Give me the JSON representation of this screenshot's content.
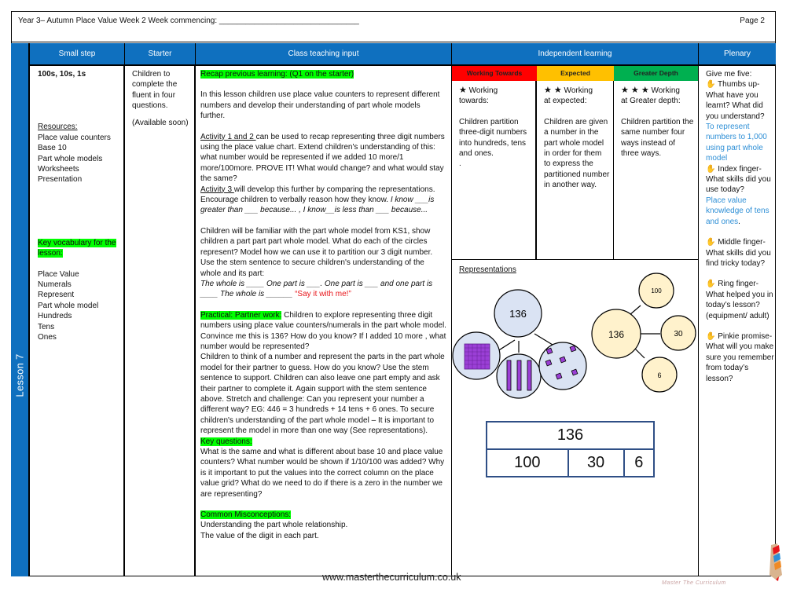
{
  "header": {
    "title": "Year 3– Autumn Place Value Week 2 Week commencing: ________________________________",
    "page": "Page 2"
  },
  "lesson_label": "Lesson 7",
  "columns": {
    "small_step": "Small step",
    "starter": "Starter",
    "class_teaching": "Class teaching input",
    "independent": "Independent learning",
    "plenary": "Plenary"
  },
  "small_step": {
    "title": "100s, 10s, 1s",
    "resources_heading": "Resources:",
    "resources": [
      "Place value counters",
      "Base 10",
      "Part whole models",
      "Worksheets",
      "Presentation"
    ],
    "vocab_heading": "Key vocabulary for the lesson:",
    "vocab": [
      "Place Value",
      "Numerals",
      "Represent",
      "Part whole model",
      "Hundreds",
      "Tens",
      "Ones"
    ]
  },
  "starter": {
    "text": "Children to complete the fluent in four questions.",
    "note": "(Available soon)"
  },
  "teaching": {
    "recap": "Recap previous learning: (Q1 on the starter)",
    "intro": "In this lesson children use place value counters to represent different numbers and develop their understanding of part whole models further.",
    "act12_label": "Activity 1 and 2 ",
    "act12_text": "can be used to recap representing three digit numbers using the place value chart.  Extend children's understanding of this:  what number would be represented if we added 10 more/1 more/100more.  PROVE IT!  What would change? and what would stay the same?",
    "act3_label": "Activity 3 ",
    "act3_text": "will develop this further by comparing the representations.  Encourage children to verbally reason how they know. ",
    "act3_italic": "I know ___is greater than ___ because... , I know__is less than ___ because...",
    "pw_intro": "Children will be familiar with the  part whole model from KS1, show children a part part part whole model. What do each of the circles represent?  Model how we can use it to partition our 3 digit number. Use the stem sentence to secure children's understanding of the whole and its part:",
    "stem_sentence": "The whole is ____ One part is ___. One part is ___ and one part is ____ The whole is ______ ",
    "say_it": "“Say it with me!”",
    "practical_label": "Practical:   Partner work:",
    "practical_text": " Children to explore representing three digit numbers using place value counters/numerals  in the part whole model.  Convince me this is 136? How do you know?  If I added 10 more , what number would be represented?",
    "partner_text": "Children to  think of a number and  represent the parts in the part whole model for their partner to guess.  How do you know? Use the stem sentence to support.  Children can also leave one part empty and ask their partner to complete it.  Again support with the stem sentence above.   Stretch and challenge:  Can you represent your number a different way?  EG: 446 = 3 hundreds + 14 tens + 6 ones. To secure children's understanding of the part whole model – It is important to represent the model  in more than one way (See representations).",
    "key_q_label": "Key questions:",
    "key_q_text": "What is the same and what is different about base 10 and place value counters?  What number would be shown if 1/10/100 was added? Why is it important to put the values into the correct column on the place value grid? What do we need to do if there is a zero in the number we are representing?",
    "misconceptions_label": " Common Misconceptions:",
    "misconceptions": [
      "Understanding the part whole relationship.",
      " The value of the digit in each part."
    ]
  },
  "independent": {
    "bands": [
      {
        "label": "Working Towards",
        "color": "#ff0000"
      },
      {
        "label": "Expected",
        "color": "#ffc000"
      },
      {
        "label": "Greater Depth",
        "color": "#00b050"
      }
    ],
    "working_towards": {
      "stars": "★",
      "heading_a": " Working",
      "heading_b": "towards:",
      "text": "Children partition three-digit numbers into hundreds, tens and ones.",
      "trail": "."
    },
    "expected": {
      "stars": "★ ★",
      "heading_a": " Working",
      "heading_b": "at expected:",
      "text": "Children are given a number in the part whole model in order for them to express the partitioned number in another way."
    },
    "greater_depth": {
      "stars": "★ ★ ★",
      "heading_a": " Working",
      "heading_b": "at Greater depth:",
      "text": "Children partition the same number four ways instead of three ways."
    },
    "representations_heading": "Representations",
    "model_a": {
      "whole": "136"
    },
    "model_b": {
      "whole": "136",
      "parts": [
        "100",
        "30",
        "6"
      ]
    },
    "bar_model": {
      "whole": "136",
      "parts": [
        "100",
        "30",
        "6"
      ]
    }
  },
  "plenary": {
    "intro": "Give me five:",
    "hand_icon": "✋",
    "items": [
      {
        "label": " Thumbs up- What have you learnt? What did you understand?",
        "answer": "To represent numbers to 1,000 using part whole model"
      },
      {
        "label": " Index finger- What skills did you use today?",
        "answer": "Place value knowledge of tens and ones"
      },
      {
        "label": " Middle finger- What skills did you find tricky today?"
      },
      {
        "label": " Ring finger- What helped you in today’s lesson? (equipment/ adult)"
      },
      {
        "label": " Pinkie promise- What will you make sure you remember from today’s lesson?"
      }
    ]
  },
  "footer": {
    "url": "www.masterthecurriculum.co.uk",
    "logo_text": "Master The Curriculum"
  },
  "colors": {
    "header_blue": "#0f70bf",
    "highlight_green": "#00ff00",
    "model_blue": "#dae3f3",
    "model_cream": "#fff2cc",
    "base10_purple": "#9b3fd6"
  }
}
